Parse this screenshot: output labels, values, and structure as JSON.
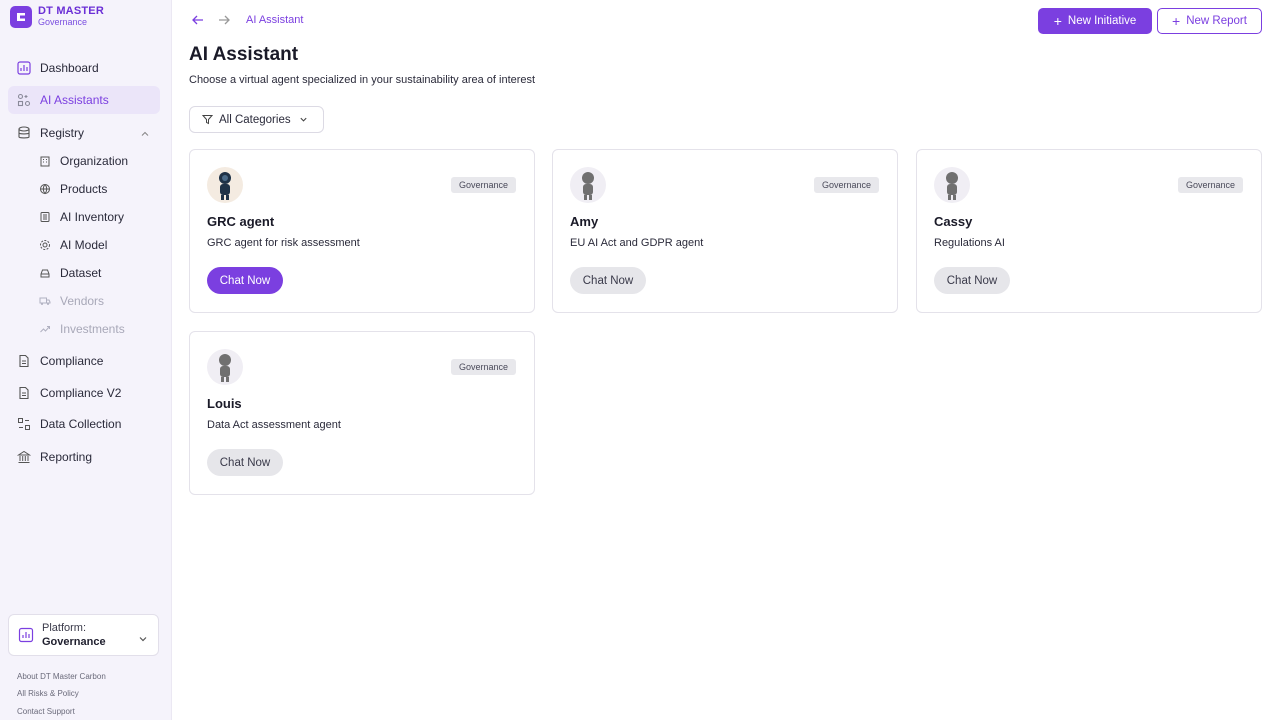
{
  "brand": {
    "name": "DT MASTER",
    "subtitle": "Governance"
  },
  "sidebar": {
    "items": [
      {
        "label": "Dashboard",
        "icon": "chart-icon"
      },
      {
        "label": "AI Assistants",
        "icon": "grid-icon",
        "active": true
      },
      {
        "label": "Registry",
        "icon": "database-icon",
        "expanded": true
      },
      {
        "label": "Compliance",
        "icon": "file-icon"
      },
      {
        "label": "Compliance V2",
        "icon": "file-icon"
      },
      {
        "label": "Data Collection",
        "icon": "collection-icon"
      },
      {
        "label": "Reporting",
        "icon": "bank-icon"
      }
    ],
    "registry_children": [
      {
        "label": "Organization",
        "icon": "building-icon"
      },
      {
        "label": "Products",
        "icon": "globe-icon"
      },
      {
        "label": "AI Inventory",
        "icon": "box-icon"
      },
      {
        "label": "AI Model",
        "icon": "gear-icon"
      },
      {
        "label": "Dataset",
        "icon": "drive-icon"
      },
      {
        "label": "Vendors",
        "icon": "truck-icon",
        "disabled": true
      },
      {
        "label": "Investments",
        "icon": "trend-icon",
        "disabled": true
      }
    ],
    "platform": {
      "label": "Platform:",
      "value": "Governance"
    },
    "footer_links": [
      "About DT Master Carbon",
      "All Risks & Policy",
      "Contact Support"
    ]
  },
  "header": {
    "breadcrumb": "AI Assistant",
    "new_initiative": "New Initiative",
    "new_report": "New Report"
  },
  "page": {
    "title": "AI Assistant",
    "subtitle": "Choose a virtual agent specialized in your sustainability area of interest",
    "filter_label": "All Categories"
  },
  "agents": [
    {
      "name": "GRC agent",
      "description": "GRC agent for risk assessment",
      "category": "Governance",
      "cta": "Chat Now"
    },
    {
      "name": "Amy",
      "description": "EU AI Act and GDPR agent",
      "category": "Governance",
      "cta": "Chat Now"
    },
    {
      "name": "Cassy",
      "description": "Regulations AI",
      "category": "Governance",
      "cta": "Chat Now"
    },
    {
      "name": "Louis",
      "description": "Data Act assessment agent",
      "category": "Governance",
      "cta": "Chat Now"
    }
  ],
  "colors": {
    "accent": "#7b3fe0",
    "sidebar_bg": "#f5f3fb",
    "badge_bg": "#e8e8ec"
  }
}
